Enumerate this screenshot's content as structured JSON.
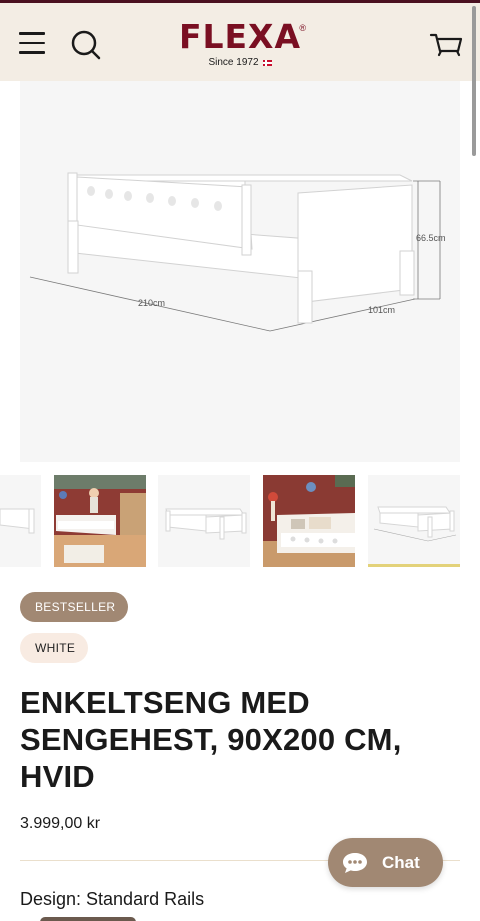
{
  "header": {
    "brand": "FLEXA",
    "brand_mark": "®",
    "since": "Since 1972",
    "menu_icon": "hamburger-menu-icon",
    "search_icon": "search-icon",
    "cart_icon": "cart-icon",
    "brand_color": "#7a0f22",
    "background": "#f3ede4"
  },
  "hero": {
    "dimensions": {
      "length": "210cm",
      "width": "101cm",
      "height": "66.5cm"
    }
  },
  "gallery": {
    "thumbnail_count": 5,
    "active_index": 4
  },
  "badges": {
    "bestseller": "BESTSELLER",
    "color": "WHITE"
  },
  "product": {
    "title": "ENKELTSENG MED SENGEHEST, 90X200 CM, HVID",
    "price": "3.999,00 kr",
    "design_label": "Design: Standard Rails"
  },
  "chat": {
    "label": "Chat",
    "icon": "chat-bubble-icon",
    "color": "#a18873"
  }
}
